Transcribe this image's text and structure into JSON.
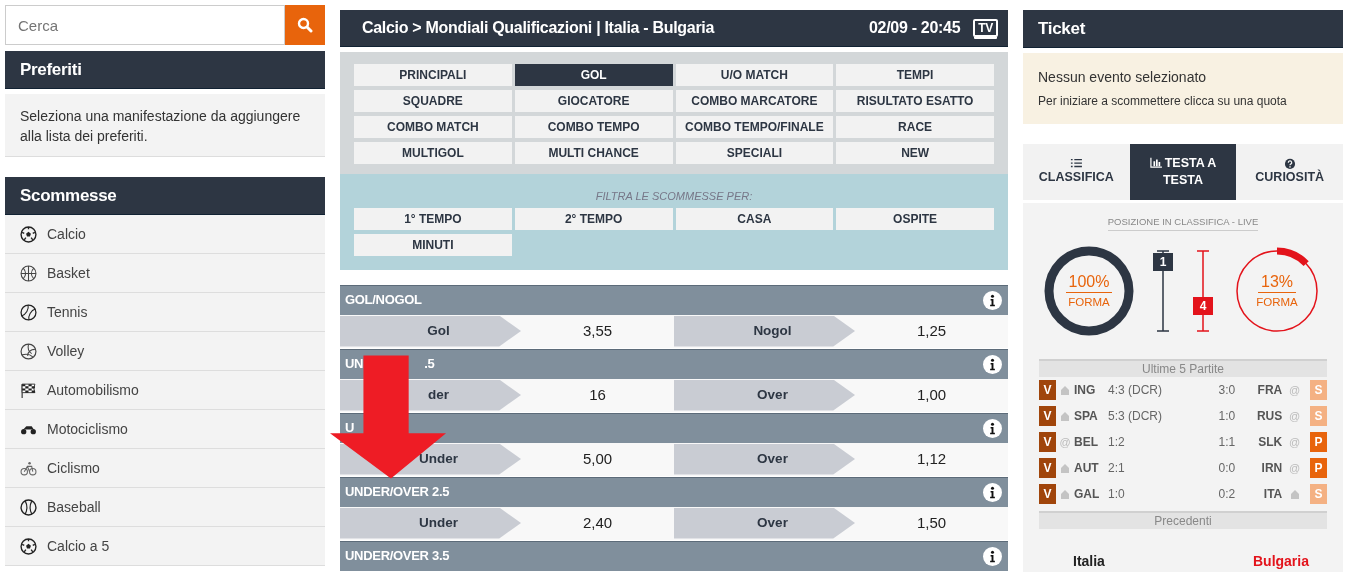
{
  "search": {
    "placeholder": "Cerca"
  },
  "favorites": {
    "title": "Preferiti",
    "text": "Seleziona una manifestazione da aggiungere alla lista dei preferiti."
  },
  "sports": {
    "title": "Scommesse",
    "items": [
      {
        "label": "Calcio",
        "kind": "soccer"
      },
      {
        "label": "Basket",
        "kind": "basketball"
      },
      {
        "label": "Tennis",
        "kind": "tennis"
      },
      {
        "label": "Volley",
        "kind": "volleyball"
      },
      {
        "label": "Automobilismo",
        "kind": "racing"
      },
      {
        "label": "Motociclismo",
        "kind": "motorbike"
      },
      {
        "label": "Ciclismo",
        "kind": "cycling"
      },
      {
        "label": "Baseball",
        "kind": "baseball"
      },
      {
        "label": "Calcio a 5",
        "kind": "soccer"
      }
    ]
  },
  "event": {
    "title": "Calcio > Mondiali Qualificazioni | Italia - Bulgaria",
    "datetime": "02/09 - 20:45",
    "tv_label": "TV"
  },
  "categories": [
    {
      "label": "PRINCIPALI",
      "selected": false
    },
    {
      "label": "GOL",
      "selected": true
    },
    {
      "label": "U/O MATCH",
      "selected": false
    },
    {
      "label": "TEMPI",
      "selected": false
    },
    {
      "label": "SQUADRE",
      "selected": false
    },
    {
      "label": "GIOCATORE",
      "selected": false
    },
    {
      "label": "COMBO MARCATORE",
      "selected": false
    },
    {
      "label": "RISULTATO ESATTO",
      "selected": false
    },
    {
      "label": "COMBO MATCH",
      "selected": false
    },
    {
      "label": "COMBO TEMPO",
      "selected": false
    },
    {
      "label": "COMBO TEMPO/FINALE",
      "selected": false
    },
    {
      "label": "RACE",
      "selected": false
    },
    {
      "label": "MULTIGOL",
      "selected": false
    },
    {
      "label": "MULTI CHANCE",
      "selected": false
    },
    {
      "label": "SPECIALI",
      "selected": false
    },
    {
      "label": "NEW",
      "selected": false
    }
  ],
  "filter": {
    "title": "FILTRA LE SCOMMESSE PER:",
    "options": [
      {
        "label": "1° TEMPO"
      },
      {
        "label": "2° TEMPO"
      },
      {
        "label": "CASA"
      },
      {
        "label": "OSPITE"
      },
      {
        "label": "MINUTI"
      }
    ]
  },
  "markets": [
    {
      "title": "GOL/NOGOL",
      "outcomes": [
        {
          "label": "Gol",
          "odds": "3,55"
        },
        {
          "label": "Nogol",
          "odds": "1,25"
        }
      ]
    },
    {
      "title": "UN",
      "title_tail": ".5",
      "outcomes": [
        {
          "label": "der",
          "odds": "16"
        },
        {
          "label": "Over",
          "odds": "1,00"
        }
      ]
    },
    {
      "title": "U",
      "outcomes": [
        {
          "label": "Under",
          "odds": "5,00"
        },
        {
          "label": "Over",
          "odds": "1,12"
        }
      ]
    },
    {
      "title": "UNDER/OVER 2.5",
      "outcomes": [
        {
          "label": "Under",
          "odds": "2,40"
        },
        {
          "label": "Over",
          "odds": "1,50"
        }
      ]
    },
    {
      "title": "UNDER/OVER 3.5"
    }
  ],
  "ticket": {
    "title": "Ticket",
    "message": "Nessun evento selezionato",
    "hint": "Per iniziare a scommettere clicca su una quota"
  },
  "stats_tabs": [
    {
      "label": "CLASSIFICA",
      "kind": "list",
      "selected": false
    },
    {
      "label": "TESTA A TESTA",
      "kind": "chart",
      "selected": true
    },
    {
      "label": "CURIOSITÀ",
      "kind": "question",
      "selected": false
    }
  ],
  "standings": {
    "title": "POSIZIONE IN CLASSIFICA - LIVE",
    "teams": [
      {
        "percent": "100%",
        "label": "FORMA",
        "level": 1,
        "color": "#2d3643",
        "marker": {
          "label": "1"
        }
      },
      {
        "percent": "13%",
        "label": "FORMA",
        "level": 0.13,
        "color": "#e3131b",
        "marker": {
          "label": "4"
        }
      }
    ]
  },
  "recent": {
    "title": "Ultime 5 Partite",
    "rows": [
      {
        "left": {
          "result": "V",
          "color": "#a0450b",
          "home": true,
          "team": "ING",
          "score": "4:3 (DCR)"
        },
        "right": {
          "score": "3:0",
          "team": "FRA",
          "home": false,
          "at": "@",
          "result": "S",
          "color": "#f4b183"
        }
      },
      {
        "left": {
          "result": "V",
          "color": "#a0450b",
          "home": true,
          "team": "SPA",
          "score": "5:3 (DCR)"
        },
        "right": {
          "score": "1:0",
          "team": "RUS",
          "home": false,
          "at": "@",
          "result": "S",
          "color": "#f4b183"
        }
      },
      {
        "left": {
          "result": "V",
          "color": "#a0450b",
          "home": false,
          "at": "@",
          "team": "BEL",
          "score": "1:2"
        },
        "right": {
          "score": "1:1",
          "team": "SLK",
          "home": false,
          "at": "@",
          "result": "P",
          "color": "#e8640c"
        }
      },
      {
        "left": {
          "result": "V",
          "color": "#a0450b",
          "home": true,
          "team": "AUT",
          "score": "2:1"
        },
        "right": {
          "score": "0:0",
          "team": "IRN",
          "home": false,
          "at": "@",
          "result": "P",
          "color": "#e8640c"
        }
      },
      {
        "left": {
          "result": "V",
          "color": "#a0450b",
          "home": true,
          "team": "GAL",
          "score": "1:0"
        },
        "right": {
          "score": "0:2",
          "team": "ITA",
          "home": true,
          "result": "S",
          "color": "#f4b183"
        }
      }
    ]
  },
  "previous": {
    "title": "Precedenti",
    "home": "Italia",
    "away": "Bulgaria"
  }
}
